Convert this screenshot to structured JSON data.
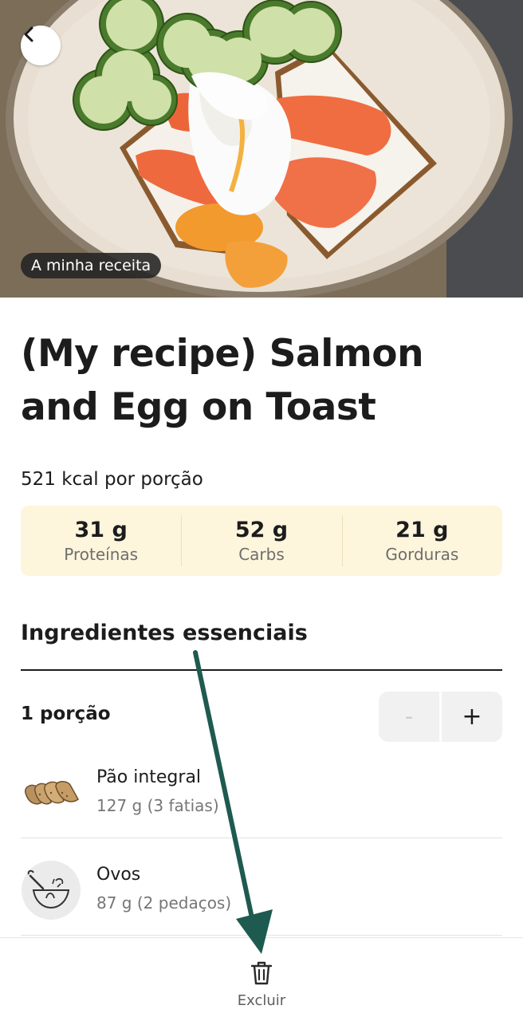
{
  "hero": {
    "badge": "A minha receita",
    "back_icon": "chevron-left-icon"
  },
  "recipe": {
    "title": "(My recipe) Salmon and Egg on Toast",
    "kcal": "521 kcal por porção"
  },
  "macros": [
    {
      "value": "31 g",
      "label": "Proteínas"
    },
    {
      "value": "52 g",
      "label": "Carbs"
    },
    {
      "value": "21 g",
      "label": "Gorduras"
    }
  ],
  "ingredients_section": {
    "title": "Ingredientes essenciais",
    "servings": "1 porção",
    "minus_label": "-",
    "plus_label": "+",
    "items": [
      {
        "name": "Pão integral",
        "qty": "127 g (3 fatias)",
        "icon": "bread-icon"
      },
      {
        "name": "Ovos",
        "qty": "87 g (2 pedaços)",
        "icon": "mixing-bowl-icon"
      }
    ]
  },
  "bottom_bar": {
    "delete_label": "Excluir",
    "delete_icon": "trash-icon"
  },
  "colors": {
    "macro_bg": "#fdf5dc",
    "annotation_arrow": "#1f5a50"
  }
}
